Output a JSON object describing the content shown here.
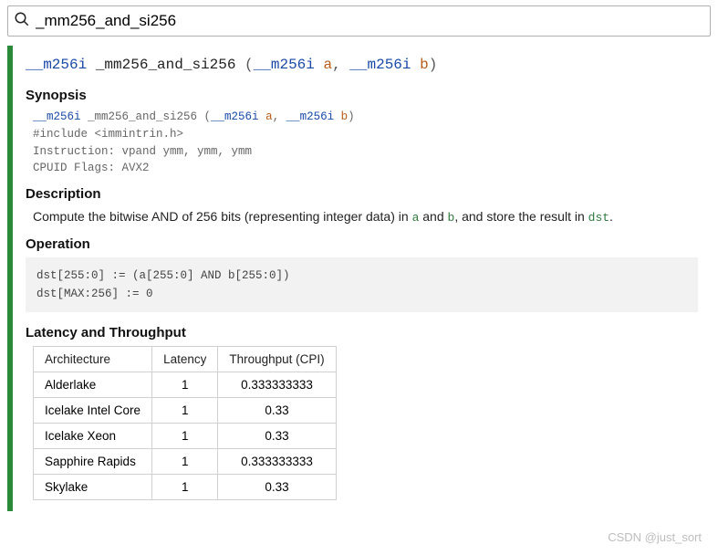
{
  "search": {
    "value": "_mm256_and_si256"
  },
  "signature": {
    "ret_type": "__m256i",
    "name": "_mm256_and_si256",
    "open": " (",
    "p1_type": "__m256i",
    "p1_name": " a",
    "sep": ", ",
    "p2_type": "__m256i",
    "p2_name": " b",
    "close": ")"
  },
  "synopsis": {
    "heading": "Synopsis",
    "sig": {
      "ret_type": "__m256i",
      "name": " _mm256_and_si256 (",
      "p1_type": "__m256i",
      "p1_name": " a",
      "sep": ", ",
      "p2_type": "__m256i",
      "p2_name": " b",
      "close": ")"
    },
    "include": "#include <immintrin.h>",
    "instruction": "Instruction: vpand ymm, ymm, ymm",
    "cpuid": "CPUID Flags: AVX2"
  },
  "description": {
    "heading": "Description",
    "t1": "Compute the bitwise AND of 256 bits (representing integer data) in ",
    "c1": "a",
    "t2": " and ",
    "c2": "b",
    "t3": ", and store the result in ",
    "c3": "dst",
    "t4": "."
  },
  "operation": {
    "heading": "Operation",
    "line1": "dst[255:0] := (a[255:0] AND b[255:0])",
    "line2": "dst[MAX:256] := 0"
  },
  "latency": {
    "heading": "Latency and Throughput",
    "headers": {
      "arch": "Architecture",
      "lat": "Latency",
      "tp": "Throughput (CPI)"
    },
    "rows": [
      {
        "arch": "Alderlake",
        "lat": "1",
        "tp": "0.333333333"
      },
      {
        "arch": "Icelake Intel Core",
        "lat": "1",
        "tp": "0.33"
      },
      {
        "arch": "Icelake Xeon",
        "lat": "1",
        "tp": "0.33"
      },
      {
        "arch": "Sapphire Rapids",
        "lat": "1",
        "tp": "0.333333333"
      },
      {
        "arch": "Skylake",
        "lat": "1",
        "tp": "0.33"
      }
    ]
  },
  "watermark": "CSDN @just_sort"
}
